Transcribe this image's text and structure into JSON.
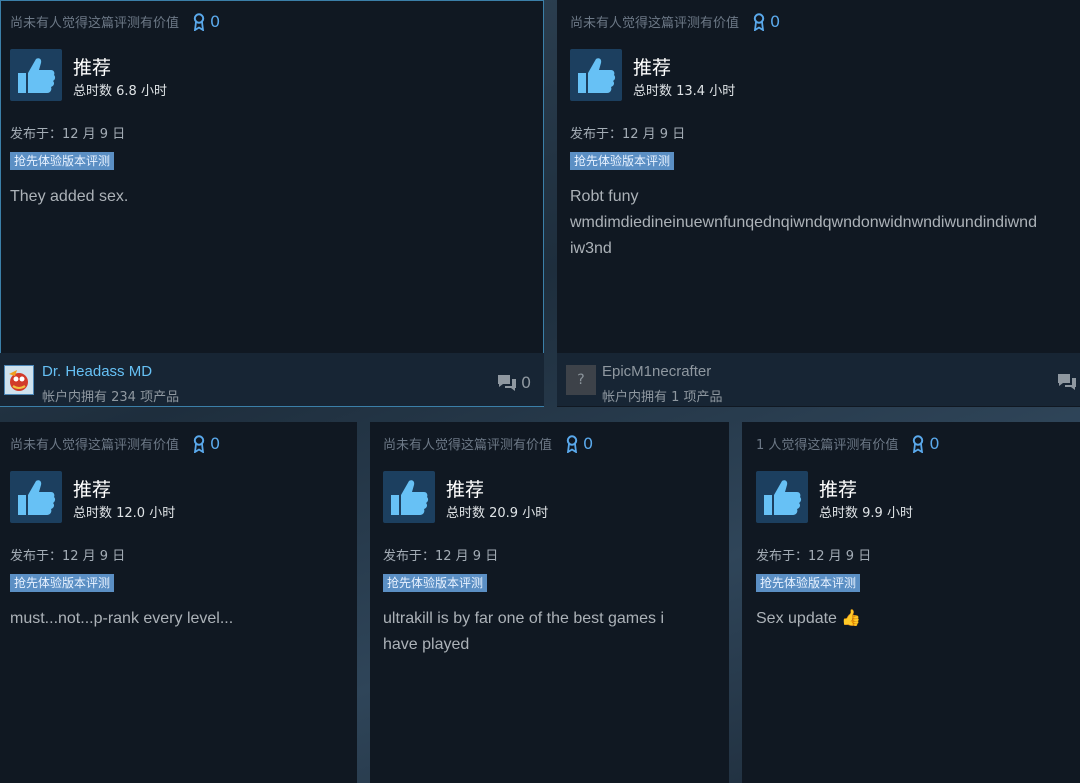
{
  "reviews": [
    {
      "helpful_text": "尚未有人觉得这篇评测有价值",
      "award_count": "0",
      "verdict": "推荐",
      "hours": "总时数 6.8 小时",
      "posted": "发布于：12 月 9 日",
      "tag": "抢先体验版本评测",
      "body": "They added sex.",
      "author": {
        "name": "Dr. Headass MD",
        "owned": "帐户内拥有 234 项产品",
        "comments": "0"
      }
    },
    {
      "helpful_text": "尚未有人觉得这篇评测有价值",
      "award_count": "0",
      "verdict": "推荐",
      "hours": "总时数 13.4 小时",
      "posted": "发布于：12 月 9 日",
      "tag": "抢先体验版本评测",
      "body": "Robt funy\nwmdimdiedineinuewnfunqednqiwndqwndonwidnwndiwundindiwnd\niw3nd",
      "author": {
        "name": "EpicM1necrafter",
        "owned": "帐户内拥有 1 项产品",
        "avatar_symbol": "?"
      }
    },
    {
      "helpful_text": "尚未有人觉得这篇评测有价值",
      "award_count": "0",
      "verdict": "推荐",
      "hours": "总时数 12.0 小时",
      "posted": "发布于：12 月 9 日",
      "tag": "抢先体验版本评测",
      "body": "must...not...p-rank every level..."
    },
    {
      "helpful_text": "尚未有人觉得这篇评测有价值",
      "award_count": "0",
      "verdict": "推荐",
      "hours": "总时数 20.9 小时",
      "posted": "发布于：12 月 9 日",
      "tag": "抢先体验版本评测",
      "body": "ultrakill is by far one of the best games i\nhave played"
    },
    {
      "helpful_text": "1 人觉得这篇评测有价值",
      "award_count": "0",
      "verdict": "推荐",
      "hours": "总时数 9.9 小时",
      "posted": "发布于：12 月 9 日",
      "tag": "抢先体验版本评测",
      "body": "Sex update 👍"
    }
  ],
  "colors": {
    "card_bg": "#101822",
    "accent_blue": "#66c0f4",
    "tag_bg": "#5b8fc4",
    "thumb_bg": "#1c3f5f"
  },
  "icons": {
    "award": "award-ribbon-icon",
    "thumb": "thumbs-up-icon",
    "comments": "speech-bubble-icon"
  }
}
